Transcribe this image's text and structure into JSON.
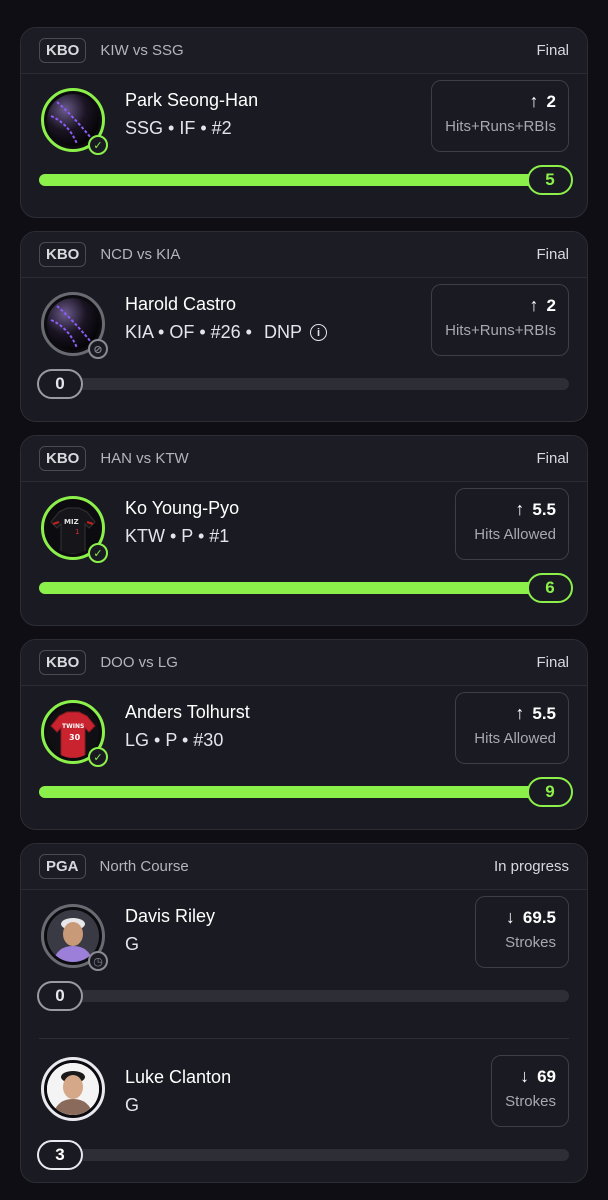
{
  "cards": [
    {
      "league": "KBO",
      "matchup": "KIW vs SSG",
      "status": "Final",
      "players": [
        {
          "name": "Park Seong-Han",
          "meta": "SSG • IF • #2",
          "dnp": "",
          "direction": "↑",
          "line": "2",
          "stat": "Hits+Runs+RBIs",
          "result": "5",
          "progress": 1.0,
          "badge": "check-icon"
        }
      ]
    },
    {
      "league": "KBO",
      "matchup": "NCD vs KIA",
      "status": "Final",
      "players": [
        {
          "name": "Harold Castro",
          "meta": "KIA • OF • #26 •",
          "dnp": "DNP",
          "direction": "↑",
          "line": "2",
          "stat": "Hits+Runs+RBIs",
          "result": "0",
          "progress": 0.0,
          "badge": "slash-icon"
        }
      ]
    },
    {
      "league": "KBO",
      "matchup": "HAN vs KTW",
      "status": "Final",
      "players": [
        {
          "name": "Ko Young-Pyo",
          "meta": "KTW • P • #1",
          "dnp": "",
          "direction": "↑",
          "line": "5.5",
          "stat": "Hits Allowed",
          "result": "6",
          "progress": 1.0,
          "badge": "check-icon",
          "jersey": "MIZ"
        }
      ]
    },
    {
      "league": "KBO",
      "matchup": "DOO vs LG",
      "status": "Final",
      "players": [
        {
          "name": "Anders Tolhurst",
          "meta": "LG • P • #30",
          "dnp": "",
          "direction": "↑",
          "line": "5.5",
          "stat": "Hits Allowed",
          "result": "9",
          "progress": 1.0,
          "badge": "check-icon",
          "jersey": "TWINS"
        }
      ]
    },
    {
      "league": "PGA",
      "matchup": "North Course",
      "status": "In progress",
      "players": [
        {
          "name": "Davis Riley",
          "meta": "G",
          "dnp": "",
          "direction": "↓",
          "line": "69.5",
          "stat": "Strokes",
          "result": "0",
          "progress": 0.0,
          "badge": "clock-icon"
        },
        {
          "name": "Luke Clanton",
          "meta": "G",
          "dnp": "",
          "direction": "↓",
          "line": "69",
          "stat": "Strokes",
          "result": "3",
          "progress": 0.0,
          "badge": ""
        }
      ]
    }
  ],
  "colors": {
    "accent": "#8cf04a",
    "card": "#1a1a22",
    "background": "#0e0e14",
    "muted": "#a8a8b2"
  }
}
